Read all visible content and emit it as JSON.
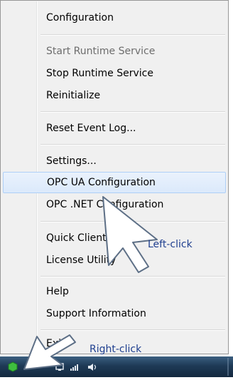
{
  "menu": {
    "items": [
      {
        "label": "Configuration",
        "state": "normal"
      },
      {
        "label": "Start Runtime Service",
        "state": "disabled"
      },
      {
        "label": "Stop Runtime Service",
        "state": "normal"
      },
      {
        "label": "Reinitialize",
        "state": "normal"
      },
      {
        "label": "Reset Event Log...",
        "state": "normal"
      },
      {
        "label": "Settings...",
        "state": "normal"
      },
      {
        "label": "OPC UA Configuration",
        "state": "highlighted"
      },
      {
        "label": "OPC .NET Configuration",
        "state": "normal"
      },
      {
        "label": "Quick Client",
        "state": "normal"
      },
      {
        "label": "License Utility",
        "state": "normal"
      },
      {
        "label": "Help",
        "state": "normal"
      },
      {
        "label": "Support Information",
        "state": "normal"
      },
      {
        "label": "Exit",
        "state": "normal"
      }
    ]
  },
  "callouts": {
    "left_click": "Left-click",
    "right_click": "Right-click"
  },
  "taskbar": {
    "icons": [
      "server-tray-icon",
      "display-icon",
      "network-signal-icon",
      "speaker-icon"
    ]
  },
  "colors": {
    "menu_bg": "#f0f0f0",
    "highlight_bg": "#dbe9fb",
    "highlight_border": "#aecff7",
    "callout_text": "#1f3f8f",
    "taskbar": "#1e3a56",
    "tray_icon": "#3fbf3f"
  }
}
